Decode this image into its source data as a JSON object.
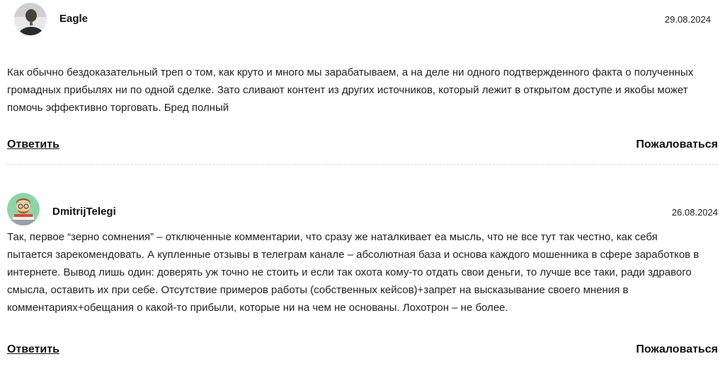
{
  "comments": [
    {
      "author": "Eagle",
      "date": "29.08.2024",
      "text": "Как обычно бездоказательный треп о том, как круто и много мы зарабатываем, а на деле ни одного подтвержденного факта о полученных громадных прибылях ни по одной сделке. Зато сливают контент из других источников, который лежит в открытом доступе и якобы может помочь эффективно торговать. Бред полный",
      "reply_label": "Ответить",
      "report_label": "Пожаловаться"
    },
    {
      "author": "DmitrijTelegi",
      "date": "26.08.2024",
      "text": "Так, первое “зерно сомнения” – отключенные комментарии, что сразу же наталкивает ea мысль, что не все тут так честно, как себя пытается зарекомендовать. А купленные отзывы в телеграм канале – абсолютная база и основа каждого мошенника в сфере заработков в интернете. Вывод лишь один: доверять уж точно не стоить и если так охота кому-то отдать свои деньги, то лучше все таки, ради здравого смысла, оставить их при себе. Отсутствие примеров работы (собственных кейсов)+запрет на высказывание своего мнения в комментариях+обещания о какой-то прибыли, которые ни на чем не основаны. Лохотрон – не более.",
      "reply_label": "Ответить",
      "report_label": "Пожаловаться"
    }
  ]
}
